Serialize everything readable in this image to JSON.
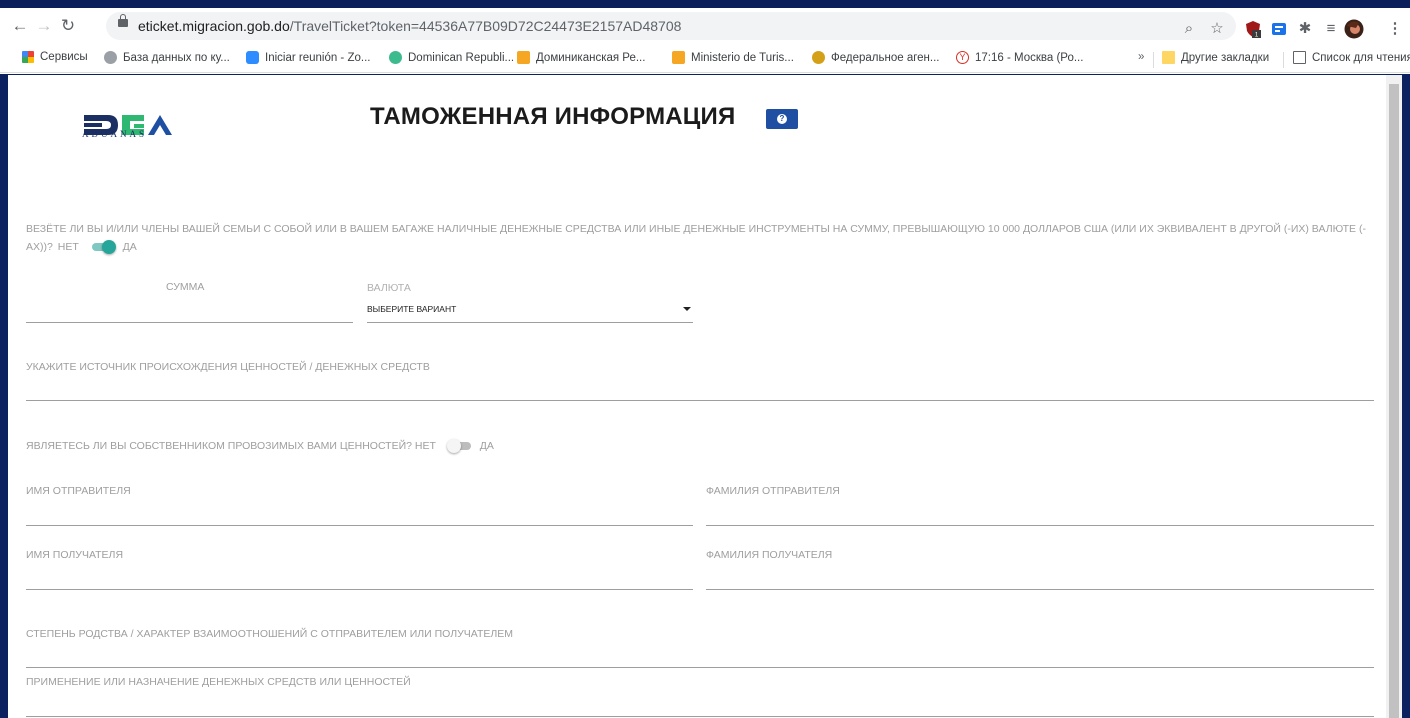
{
  "browser": {
    "url_host": "eticket.migracion.gob.do",
    "url_path": "/TravelTicket?token=44536A77B09D72C24473E2157AD48708",
    "bookmarks": [
      "Сервисы",
      "База данных по ку...",
      "Iniciar reunión - Zo...",
      "Dominican Republi...",
      "Доминиканская Ре...",
      "Ministerio de Turis...",
      "Федеральное аген...",
      "17:16 - Москва (Ро..."
    ],
    "overflow_label": "»",
    "other_bookmarks": "Другие закладки",
    "reading_list": "Список для чтения",
    "extension_badge": "1"
  },
  "header": {
    "logo_sub": "ADUANAS",
    "title": "ТАМОЖЕННАЯ ИНФОРМАЦИЯ",
    "help_icon": "?"
  },
  "form": {
    "cash_question": "ВЕЗЁТЕ ЛИ ВЫ И/ИЛИ ЧЛЕНЫ ВАШЕЙ СЕМЬИ С СОБОЙ ИЛИ В ВАШЕМ БАГАЖЕ НАЛИЧНЫЕ ДЕНЕЖНЫЕ СРЕДСТВА ИЛИ ИНЫЕ ДЕНЕЖНЫЕ ИНСТРУМЕНТЫ НА СУММУ, ПРЕВЫШАЮЩУЮ 10 000 ДОЛЛАРОВ США (ИЛИ ИХ ЭКВИВАЛЕНТ В ДРУГОЙ (-ИХ) ВАЛЮТЕ (-АХ))?",
    "no": "НЕТ",
    "yes": "ДА",
    "cash_toggle_on": true,
    "amount_label": "СУММА",
    "currency_label": "ВАЛЮТА",
    "currency_value": "ВЫБЕРИТЕ ВАРИАНТ",
    "source_label": "УКАЖИТЕ ИСТОЧНИК ПРОИСХОЖДЕНИЯ ЦЕННОСТЕЙ / ДЕНЕЖНЫХ СРЕДСТВ",
    "owner_question": "ЯВЛЯЕТЕСЬ ЛИ ВЫ СОБСТВЕННИКОМ ПРОВОЗИМЫХ ВАМИ ЦЕННОСТЕЙ?",
    "owner_toggle_on": false,
    "sender_first": "ИМЯ ОТПРАВИТЕЛЯ",
    "sender_last": "ФАМИЛИЯ ОТПРАВИТЕЛЯ",
    "recipient_first": "ИМЯ ПОЛУЧАТЕЛЯ",
    "recipient_last": "ФАМИЛИЯ ПОЛУЧАТЕЛЯ",
    "relationship": "СТЕПЕНЬ РОДСТВА / ХАРАКТЕР ВЗАИМООТНОШЕНИЙ С ОТПРАВИТЕЛЕМ ИЛИ ПОЛУЧАТЕЛЕМ",
    "purpose": "ПРИМЕНЕНИЕ ИЛИ НАЗНАЧЕНИЕ ДЕНЕЖНЫХ СРЕДСТВ ИЛИ ЦЕННОСТЕЙ"
  },
  "colors": {
    "frame": "#0c2260",
    "brand_blue": "#1e4fa3",
    "toggle_on": "#26a69a",
    "label_gray": "#9e9e9e"
  }
}
